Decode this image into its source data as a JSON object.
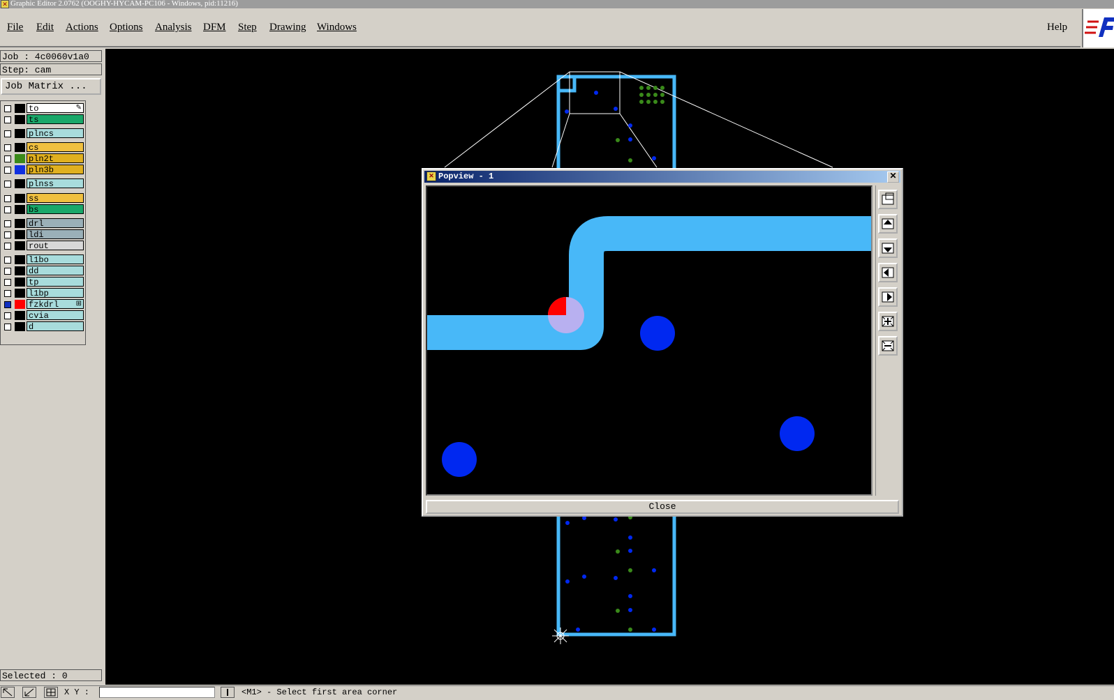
{
  "window": {
    "title": "Graphic Editor 2.0762 (OOGHY-HYCAM-PC106 - Windows, pid:11216)"
  },
  "menu": {
    "items": [
      {
        "label": "File"
      },
      {
        "label": "Edit"
      },
      {
        "label": "Actions"
      },
      {
        "label": "Options"
      },
      {
        "label": "Analysis"
      },
      {
        "label": "DFM"
      },
      {
        "label": "Step"
      },
      {
        "label": "Drawing"
      },
      {
        "label": "Windows"
      }
    ],
    "help": "Help"
  },
  "job": {
    "job_line": "Job : 4c0060v1a0",
    "step_line": "Step: cam",
    "matrix_button": "Job Matrix ..."
  },
  "layers": [
    {
      "name": "to",
      "color": "#ffffff",
      "swatch": "#000000",
      "checked": false
    },
    {
      "name": "ts",
      "color": "#1aa86a",
      "swatch": "#000000",
      "checked": false
    },
    {
      "name": "plncs",
      "color": "#a8dcdc",
      "swatch": "#000000",
      "checked": false
    },
    {
      "name": "cs",
      "color": "#f0c040",
      "swatch": "#000000",
      "checked": false
    },
    {
      "name": "pln2t",
      "color": "#e0b020",
      "swatch": "#3a8a1a",
      "checked": false
    },
    {
      "name": "pln3b",
      "color": "#e0b020",
      "swatch": "#1030e0",
      "checked": false
    },
    {
      "name": "plnss",
      "color": "#a8dcdc",
      "swatch": "#000000",
      "checked": false
    },
    {
      "name": "ss",
      "color": "#f0c040",
      "swatch": "#000000",
      "checked": false
    },
    {
      "name": "bs",
      "color": "#1aa86a",
      "swatch": "#000000",
      "checked": false
    },
    {
      "name": "drl",
      "color": "#9ab0b8",
      "swatch": "#000000",
      "checked": false
    },
    {
      "name": "ldi",
      "color": "#9ab0b8",
      "swatch": "#000000",
      "checked": false
    },
    {
      "name": "rout",
      "color": "#d8d8d8",
      "swatch": "#000000",
      "checked": false
    },
    {
      "name": "l1bo",
      "color": "#a8dcdc",
      "swatch": "#000000",
      "checked": false
    },
    {
      "name": "dd",
      "color": "#a8dcdc",
      "swatch": "#000000",
      "checked": false
    },
    {
      "name": "tp",
      "color": "#a8dcdc",
      "swatch": "#000000",
      "checked": false
    },
    {
      "name": "l1bp",
      "color": "#a8dcdc",
      "swatch": "#000000",
      "checked": false
    },
    {
      "name": "fzkdrl",
      "color": "#a8dcdc",
      "swatch": "#ff0000",
      "checked": true
    },
    {
      "name": "cvia",
      "color": "#a8dcdc",
      "swatch": "#000000",
      "checked": false
    },
    {
      "name": "d",
      "color": "#a8dcdc",
      "swatch": "#000000",
      "checked": false
    }
  ],
  "selection": {
    "label": "Selected : 0"
  },
  "status": {
    "xy_label": "X Y :",
    "xy_value": "",
    "message": "<M1> - Select first area corner"
  },
  "popview": {
    "title": "Popview - 1",
    "close_button": "Close"
  },
  "colors": {
    "trace": "#48b8f8",
    "via_blue": "#0028f0",
    "via_green": "#3a8a1a",
    "highlight_red": "#ff0000",
    "highlight_pink": "#b8b0f0"
  }
}
